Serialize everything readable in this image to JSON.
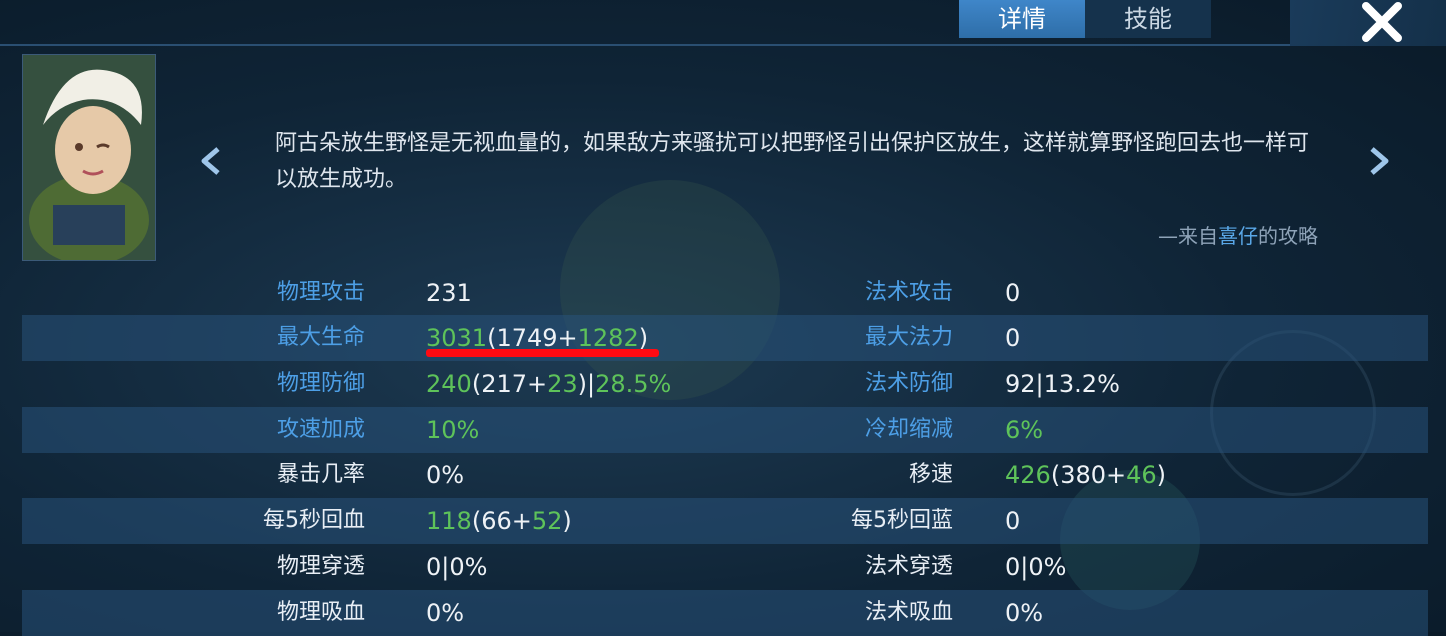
{
  "tabs": {
    "details": "详情",
    "skills": "技能"
  },
  "tip": {
    "text": "阿古朵放生野怪是无视血量的，如果敌方来骚扰可以把野怪引出保护区放生，这样就算野怪跑回去也一样可以放生成功。"
  },
  "source": {
    "prefix": "—来自",
    "author": "喜仔",
    "suffix": "的攻略"
  },
  "stats": [
    {
      "left_label": "物理攻击",
      "left_value": "231",
      "right_label": "法术攻击",
      "right_value": "0"
    },
    {
      "left_label": "最大生命",
      "left_value": "3031(1749+1282)",
      "right_label": "最大法力",
      "right_value": "0"
    },
    {
      "left_label": "物理防御",
      "left_value": "240(217+23)|28.5%",
      "right_label": "法术防御",
      "right_value": "92|13.2%"
    },
    {
      "left_label": "攻速加成",
      "left_value": "10%",
      "right_label": "冷却缩减",
      "right_value": "6%"
    },
    {
      "left_label": "暴击几率",
      "left_value": "0%",
      "right_label": "移速",
      "right_value": "426(380+46)"
    },
    {
      "left_label": "每5秒回血",
      "left_value": "118(66+52)",
      "right_label": "每5秒回蓝",
      "right_value": "0"
    },
    {
      "left_label": "物理穿透",
      "left_value": "0|0%",
      "right_label": "法术穿透",
      "right_value": "0|0%"
    },
    {
      "left_label": "物理吸血",
      "left_value": "0%",
      "right_label": "法术吸血",
      "right_value": "0%"
    }
  ],
  "colors": {
    "accent_blue": "#4d9fe6",
    "bonus_green": "#5ec35a",
    "highlight_red": "#ff0a12"
  },
  "icons": {
    "prev": "chevron-left-icon",
    "next": "chevron-right-icon",
    "close": "close-icon"
  }
}
